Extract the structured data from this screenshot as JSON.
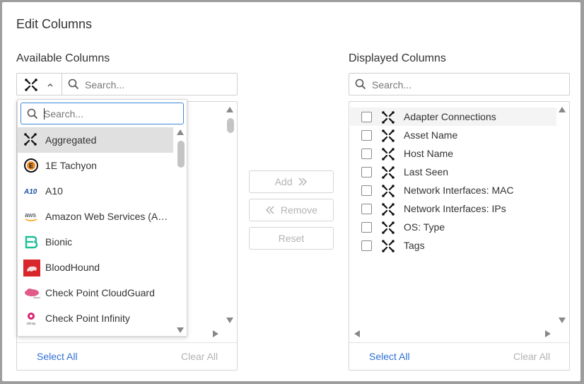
{
  "dialog": {
    "title": "Edit Columns"
  },
  "available": {
    "label": "Available Columns",
    "search_placeholder": "Search...",
    "select_all": "Select All",
    "clear_all": "Clear All"
  },
  "displayed": {
    "label": "Displayed Columns",
    "search_placeholder": "Search...",
    "select_all": "Select All",
    "clear_all": "Clear All",
    "items": [
      {
        "label": "Adapter Connections",
        "checked": false
      },
      {
        "label": "Asset Name",
        "checked": false
      },
      {
        "label": "Host Name",
        "checked": false
      },
      {
        "label": "Last Seen",
        "checked": false
      },
      {
        "label": "Network Interfaces: MAC",
        "checked": false
      },
      {
        "label": "Network Interfaces: IPs",
        "checked": false
      },
      {
        "label": "OS: Type",
        "checked": false
      },
      {
        "label": "Tags",
        "checked": false
      }
    ]
  },
  "actions": {
    "add": "Add",
    "remove": "Remove",
    "reset": "Reset"
  },
  "adapter_dropdown": {
    "search_placeholder": "Search...",
    "selected": "Aggregated",
    "items": [
      {
        "label": "Aggregated",
        "icon": "aggregated-icon"
      },
      {
        "label": "1E Tachyon",
        "icon": "1e-tachyon-logo-icon"
      },
      {
        "label": "A10",
        "icon": "a10-logo-icon"
      },
      {
        "label": "Amazon Web Services (A…",
        "icon": "aws-logo-icon"
      },
      {
        "label": "Bionic",
        "icon": "bionic-logo-icon"
      },
      {
        "label": "BloodHound",
        "icon": "bloodhound-logo-icon"
      },
      {
        "label": "Check Point CloudGuard",
        "icon": "checkpoint-cloudguard-logo-icon"
      },
      {
        "label": "Check Point Infinity",
        "icon": "checkpoint-infinity-logo-icon"
      }
    ]
  },
  "colors": {
    "link": "#2f6fd6",
    "focus": "#3b8ad9",
    "disabled": "#b3b3b3",
    "bloodhound": "#d8262a",
    "bionic": "#1fbf9a"
  }
}
